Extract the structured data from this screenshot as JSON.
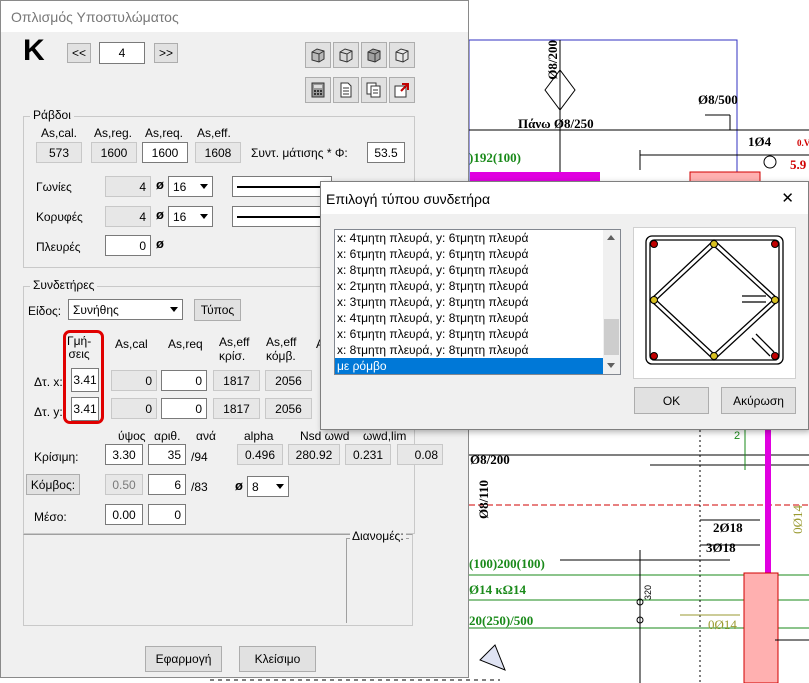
{
  "main_window": {
    "title": "Οπλισμός Υποστυλώματος",
    "column_letter": "K",
    "nav": {
      "prev": "<<",
      "index": "4",
      "next": ">>"
    }
  },
  "bars": {
    "group_title": "Ράβδοι",
    "headers": [
      "As,cal.",
      "As,reg.",
      "As,req.",
      "As,eff."
    ],
    "values": [
      "573",
      "1600",
      "1600",
      "1608"
    ],
    "factor_label": "Συντ. μάτισης * Φ:",
    "factor_value": "53.5",
    "rows": [
      {
        "label": "Γωνίες",
        "count": "4",
        "diameter": "16"
      },
      {
        "label": "Κορυφές",
        "count": "4",
        "diameter": "16"
      },
      {
        "label": "Πλευρές",
        "count": "0"
      }
    ],
    "phi_symbol": "ø"
  },
  "stirrups": {
    "group_title": "Συνδετήρες",
    "type_label": "Είδος:",
    "type_value": "Συνήθης",
    "types_button": "Τύπος",
    "col_headers": {
      "legs": "Γμή-\nσεις",
      "as_cal": "As,cal",
      "as_req": "As,req",
      "as_eff_crit": "As,eff\nκρίσ.",
      "as_eff_node": "As,eff\nκόμβ.",
      "clipped": "A"
    },
    "rows": [
      {
        "label": "Δτ. x:",
        "legs": "3.41",
        "as_cal": "0",
        "as_req": "0",
        "as_eff_crit": "1817",
        "as_eff_node": "2056"
      },
      {
        "label": "Δτ. y:",
        "legs": "3.41",
        "as_cal": "0",
        "as_req": "0",
        "as_eff_crit": "1817",
        "as_eff_node": "2056"
      }
    ],
    "grid_headers": [
      "ύψος",
      "αριθ.",
      "ανά",
      "alpha",
      "Nsd ωwd",
      "ωwd,lim"
    ],
    "critical": {
      "label": "Κρίσιμη:",
      "height": "3.30",
      "count": "35",
      "per": "/94",
      "alpha": "0.496",
      "nsd": "280.92",
      "wwd": "0.231",
      "wlim": "0.08"
    },
    "node": {
      "label": "Κόμβος:",
      "height": "0.50",
      "count": "6",
      "per": "/83",
      "diameter": "8"
    },
    "middle": {
      "label": "Μέσο:",
      "height": "0.00",
      "count": "0"
    },
    "distributions_label": "Διανομές:"
  },
  "buttons": {
    "apply": "Εφαρμογή",
    "close": "Κλείσιμο"
  },
  "dialog": {
    "title": "Επιλογή τύπου συνδετήρα",
    "close_glyph": "✕",
    "options": [
      "x: 4τμητη πλευρά, y: 6τμητη πλευρά",
      "x: 6τμητη πλευρά, y: 6τμητη πλευρά",
      "x: 8τμητη πλευρά, y: 6τμητη πλευρά",
      "x: 2τμητη πλευρά, y: 8τμητη πλευρά",
      "x: 3τμητη πλευρά, y: 8τμητη πλευρά",
      "x: 4τμητη πλευρά, y: 8τμητη πλευρά",
      "x: 6τμητη πλευρά, y: 8τμητη πλευρά",
      "x: 8τμητη πλευρά, y: 8τμητη πλευρά",
      "με ρόμβο"
    ],
    "selected_index": 8,
    "ok": "OK",
    "cancel": "Ακύρωση"
  },
  "cad": {
    "labels": [
      "Ø8/200",
      "Ø8/500",
      "Πάνω Ø8/250",
      "1Ø4",
      "0.V",
      "5.9",
      ")192(100)",
      "Ø8/200",
      "Ø8/110",
      "2Ø18",
      "3Ø18",
      "(100)200(100)",
      "Ø14 κΩ14",
      "0Ø14",
      "20(250)/500",
      "0Ø14",
      "320",
      "2"
    ]
  },
  "colors": {
    "accent": "#0078d7",
    "magenta": "#e000e0",
    "cad_green": "#1a8a1a",
    "highlight_red": "#e00000"
  }
}
